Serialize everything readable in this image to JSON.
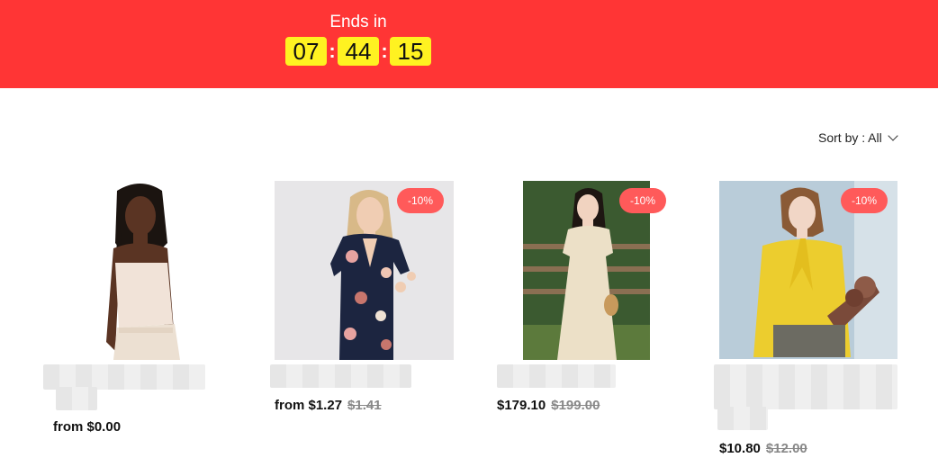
{
  "countdown": {
    "label": "Ends in",
    "hours": "07",
    "minutes": "44",
    "seconds": "15",
    "separator": ":"
  },
  "sort": {
    "label": "Sort by :",
    "value": "All"
  },
  "products": [
    {
      "price": "from $0.00",
      "old_price": "",
      "badge": ""
    },
    {
      "price": "from $1.27",
      "old_price": "$1.41",
      "badge": "-10%"
    },
    {
      "price": "$179.10",
      "old_price": "$199.00",
      "badge": "-10%"
    },
    {
      "price": "$10.80",
      "old_price": "$12.00",
      "badge": "-10%"
    }
  ],
  "colors": {
    "banner": "#ff3535",
    "timer_box": "#fff221",
    "badge": "#ff5a5a"
  }
}
